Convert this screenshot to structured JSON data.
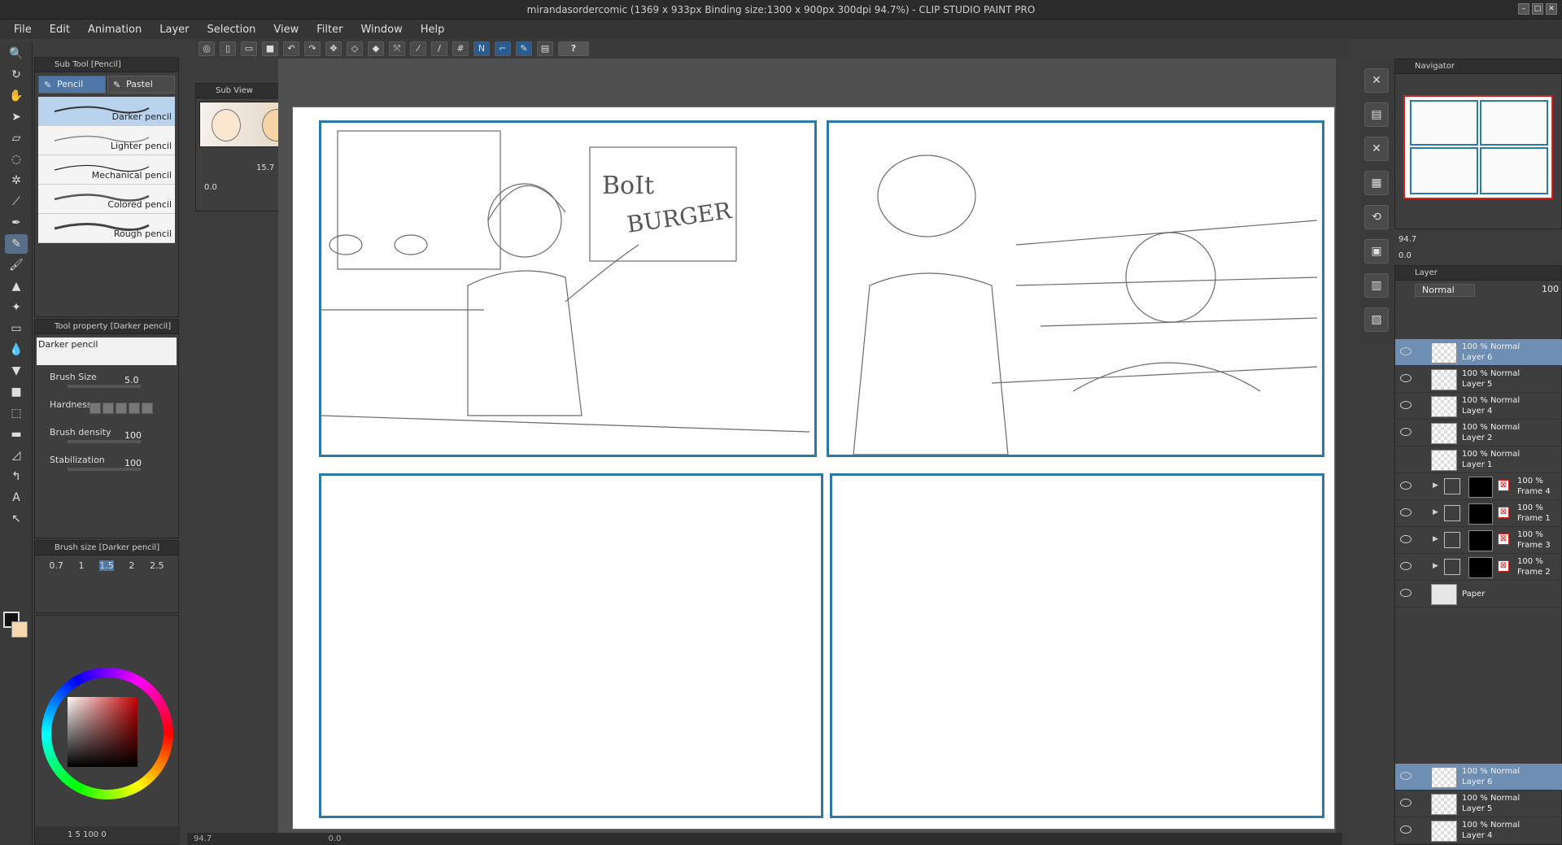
{
  "title": "mirandasordercomic (1369 x 933px Binding size:1300 x 900px 300dpi 94.7%) - CLIP STUDIO PAINT PRO",
  "window_buttons": [
    "–",
    "□",
    "✕"
  ],
  "menu": [
    "File",
    "Edit",
    "Animation",
    "Layer",
    "Selection",
    "View",
    "Filter",
    "Window",
    "Help"
  ],
  "toolbar": {
    "help_label": "?"
  },
  "subtool": {
    "title": "Sub Tool [Pencil]",
    "tabs": [
      "Pencil",
      "Pastel"
    ],
    "brushes": [
      "Darker pencil",
      "Lighter pencil",
      "Mechanical pencil",
      "Colored pencil",
      "Rough pencil"
    ]
  },
  "tool_property": {
    "title": "Tool property [Darker pencil]",
    "preview_label": "Darker pencil",
    "brush_size_label": "Brush Size",
    "brush_size_value": "5.0",
    "hardness_label": "Hardness",
    "density_label": "Brush density",
    "density_value": "100",
    "stabilization_label": "Stabilization",
    "stabilization_value": "100"
  },
  "brush_size": {
    "title": "Brush size [Darker pencil]",
    "sizes": [
      "0.7",
      "1",
      "1.5",
      "2",
      "2.5"
    ]
  },
  "color": {
    "main": "#111111",
    "sub": "#f6d7b0",
    "footer": "1  5  100  0"
  },
  "subview": {
    "title": "Sub View",
    "zoom": "15.7",
    "angle": "0.0"
  },
  "canvas": {
    "panel1_sign_top": "BoIt",
    "panel1_sign_bottom": "BURGER"
  },
  "status": {
    "zoom": "94.7",
    "angle": "0.0"
  },
  "navigator": {
    "title": "Navigator",
    "zoom": "94.7",
    "angle": "0.0"
  },
  "layer_panel": {
    "title": "Layer",
    "blend": "Normal",
    "opacity": "100",
    "layers": [
      {
        "line1": "100 % Normal",
        "line2": "Layer 6"
      },
      {
        "line1": "100 % Normal",
        "line2": "Layer 5"
      },
      {
        "line1": "100 % Normal",
        "line2": "Layer 4"
      },
      {
        "line1": "100 % Normal",
        "line2": "Layer 2"
      },
      {
        "line1": "100 % Normal",
        "line2": "Layer 1"
      }
    ],
    "frames": [
      {
        "line1": "100 %",
        "line2": "Frame 4"
      },
      {
        "line1": "100 %",
        "line2": "Frame 1"
      },
      {
        "line1": "100 %",
        "line2": "Frame 3"
      },
      {
        "line1": "100 %",
        "line2": "Frame 2"
      }
    ],
    "paper": "Paper",
    "mini": [
      {
        "line1": "100 % Normal",
        "line2": "Layer 6"
      },
      {
        "line1": "100 % Normal",
        "line2": "Layer 5"
      },
      {
        "line1": "100 % Normal",
        "line2": "Layer 4"
      }
    ]
  }
}
